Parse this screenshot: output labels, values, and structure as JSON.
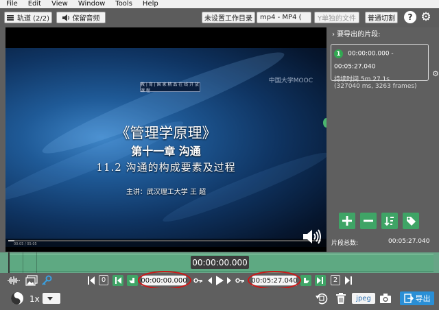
{
  "menu": [
    "File",
    "Edit",
    "View",
    "Window",
    "Tools",
    "Help"
  ],
  "toolbar": {
    "tracks_label": "轨道 (2/2)",
    "keep_audio_label": "保留音频",
    "workdir_label": "未设置工作目录",
    "format_label": "mp4 - MP4 (",
    "single_file_label": "Y单独的文件",
    "cut_mode_label": "普通切割",
    "help_label": "?"
  },
  "video": {
    "center_badge": "教 | 育 | 国 家 精 品 在 线 开 放 课 程",
    "logo": "中国大学MOOC",
    "title": "《管理学原理》",
    "chapter": "第十一章  沟通",
    "section": "11.2  沟通的构成要素及过程",
    "lecturer": "主讲：武汉理工大学  王  超",
    "player_time": "00:05 / 05:05",
    "player_progress": 0.02
  },
  "segments_panel": {
    "header": "要导出的片段:",
    "segments": [
      {
        "index": "1",
        "range": "00:00:00.000 - 00:05:27.040",
        "duration": "持续时间 5m 27.1s",
        "details": "(327040 ms, 3263 frames)"
      }
    ],
    "total_label": "片段总数:",
    "total_value": "00:05:27.040"
  },
  "timeline": {
    "current_time": "00:00:00.000"
  },
  "controls": {
    "start_index": "0",
    "cut_start": "00:00:00.000",
    "cut_end": "00:05:27.040",
    "end_index": "2"
  },
  "bottom": {
    "speed": "1x",
    "snapshot_format": "jpeg",
    "export_label": "导出"
  },
  "colors": {
    "accent_green": "#3fa466",
    "timeline_green": "#67a587",
    "export_blue": "#2a8fd6",
    "highlight_red": "#d11414"
  }
}
